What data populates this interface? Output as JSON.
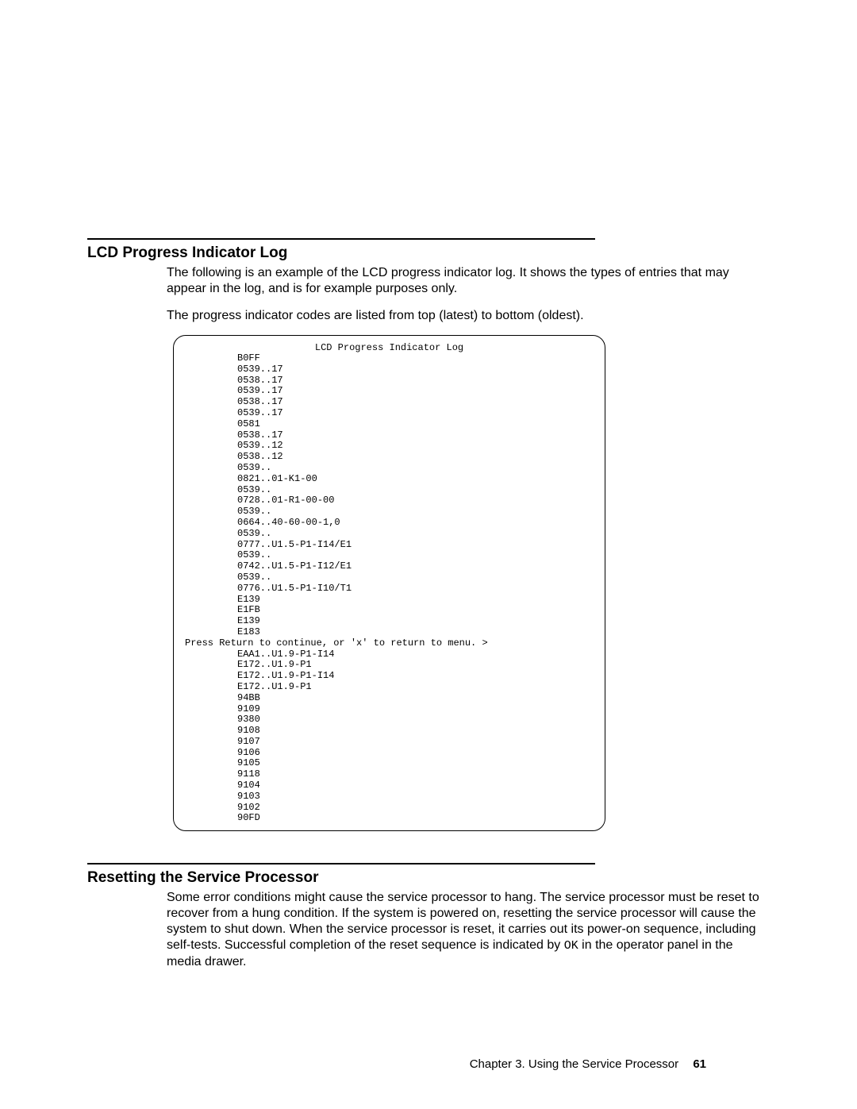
{
  "section1": {
    "title": "LCD Progress Indicator Log",
    "para1": "The following is an example of the LCD progress indicator log. It shows the types of entries that may appear in the log, and is for example purposes only.",
    "para2": "The progress indicator codes are listed from top (latest) to bottom (oldest)."
  },
  "log": {
    "title": "LCD Progress Indicator Log",
    "lines": [
      {
        "t": "B0FF",
        "indent": true
      },
      {
        "t": "0539..17",
        "indent": true
      },
      {
        "t": "0538..17",
        "indent": true
      },
      {
        "t": "0539..17",
        "indent": true
      },
      {
        "t": "0538..17",
        "indent": true
      },
      {
        "t": "0539..17",
        "indent": true
      },
      {
        "t": "0581",
        "indent": true
      },
      {
        "t": "0538..17",
        "indent": true
      },
      {
        "t": "0539..12",
        "indent": true
      },
      {
        "t": "0538..12",
        "indent": true
      },
      {
        "t": "0539..",
        "indent": true
      },
      {
        "t": "0821..01-K1-00",
        "indent": true
      },
      {
        "t": "0539..",
        "indent": true
      },
      {
        "t": "0728..01-R1-00-00",
        "indent": true
      },
      {
        "t": "0539..",
        "indent": true
      },
      {
        "t": "0664..40-60-00-1,0",
        "indent": true
      },
      {
        "t": "0539..",
        "indent": true
      },
      {
        "t": "0777..U1.5-P1-I14/E1",
        "indent": true
      },
      {
        "t": "0539..",
        "indent": true
      },
      {
        "t": "0742..U1.5-P1-I12/E1",
        "indent": true
      },
      {
        "t": "0539..",
        "indent": true
      },
      {
        "t": "0776..U1.5-P1-I10/T1",
        "indent": true
      },
      {
        "t": "E139",
        "indent": true
      },
      {
        "t": "E1FB",
        "indent": true
      },
      {
        "t": "E139",
        "indent": true
      },
      {
        "t": "E183",
        "indent": true
      },
      {
        "t": "Press Return to continue, or 'x' to return to menu. >",
        "indent": false
      },
      {
        "t": "EAA1..U1.9-P1-I14",
        "indent": true
      },
      {
        "t": "E172..U1.9-P1",
        "indent": true
      },
      {
        "t": "E172..U1.9-P1-I14",
        "indent": true
      },
      {
        "t": "E172..U1.9-P1",
        "indent": true
      },
      {
        "t": "94BB",
        "indent": true
      },
      {
        "t": "9109",
        "indent": true
      },
      {
        "t": "9380",
        "indent": true
      },
      {
        "t": "9108",
        "indent": true
      },
      {
        "t": "9107",
        "indent": true
      },
      {
        "t": "9106",
        "indent": true
      },
      {
        "t": "9105",
        "indent": true
      },
      {
        "t": "9118",
        "indent": true
      },
      {
        "t": "9104",
        "indent": true
      },
      {
        "t": "9103",
        "indent": true
      },
      {
        "t": "9102",
        "indent": true
      },
      {
        "t": "90FD",
        "indent": true
      }
    ]
  },
  "section2": {
    "title": "Resetting the Service Processor",
    "para_pre": "Some error conditions might cause the service processor to hang. The service processor must be reset to recover from a hung condition. If the system is powered on, resetting the service processor will cause the system to shut down. When the service processor is reset, it carries out its power-on sequence, including self-tests. Successful completion of the reset sequence is indicated by ",
    "para_code": "OK",
    "para_post": " in the operator panel in the media drawer."
  },
  "footer": {
    "chapter": "Chapter 3. Using the Service Processor",
    "page": "61"
  }
}
